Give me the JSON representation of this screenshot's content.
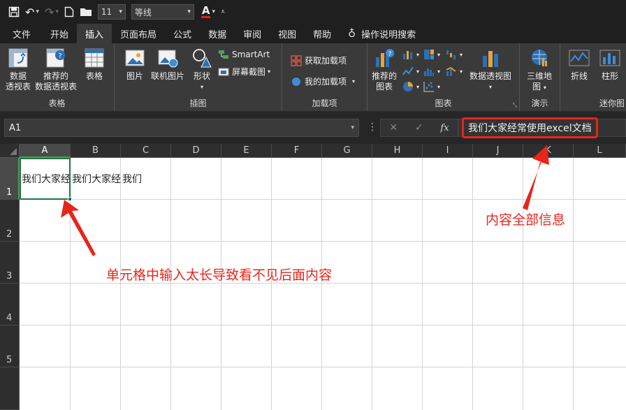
{
  "qat": {
    "font_size": "11",
    "font_name": "等线",
    "font_color_glyph": "A"
  },
  "tabs": [
    {
      "label": "文件"
    },
    {
      "label": "开始"
    },
    {
      "label": "插入"
    },
    {
      "label": "页面布局"
    },
    {
      "label": "公式"
    },
    {
      "label": "数据"
    },
    {
      "label": "审阅"
    },
    {
      "label": "视图"
    },
    {
      "label": "帮助"
    },
    {
      "label": "操作说明搜索"
    }
  ],
  "active_tab": "插入",
  "ribbon": {
    "tables": {
      "label": "表格",
      "pivot": [
        "数据",
        "透视表"
      ],
      "rec_pivot": [
        "推荐的",
        "数据透视表"
      ],
      "table": "表格"
    },
    "illustrations": {
      "label": "插图",
      "picture": "图片",
      "online_picture": "联机图片",
      "shapes": "形状",
      "smartart": "SmartArt",
      "screenshot": "屏幕截图"
    },
    "addins": {
      "label": "加载项",
      "get_addins": "获取加载项",
      "my_addins": "我的加载项"
    },
    "charts": {
      "label": "图表",
      "rec_charts": [
        "推荐的",
        "图表"
      ],
      "pivot_chart": "数据透视图"
    },
    "tours": {
      "label": "演示",
      "map3d": [
        "三维地",
        "图"
      ]
    },
    "sparklines": {
      "label": "迷你图",
      "line": "折线",
      "column": "柱形"
    }
  },
  "formula_bar": {
    "name_box": "A1",
    "cancel_glyph": "✕",
    "enter_glyph": "✓",
    "fx_glyph": "fx",
    "content": "我们大家经常使用excel文档"
  },
  "grid": {
    "columns": [
      "A",
      "B",
      "C",
      "D",
      "E",
      "F",
      "G",
      "H",
      "I",
      "J",
      "K",
      "L"
    ],
    "rows": [
      "1",
      "2",
      "3",
      "4",
      "5"
    ],
    "selected_column": "A",
    "selected_row": "1",
    "cell_a1_visible": "我们大家经",
    "cell_b1_visible": "我们大家经",
    "cell_c1_visible": "我们"
  },
  "annotations": {
    "right_note": "内容全部信息",
    "bottom_note": "单元格中输入太长导致看不见后面内容",
    "color": "#e8251b"
  }
}
